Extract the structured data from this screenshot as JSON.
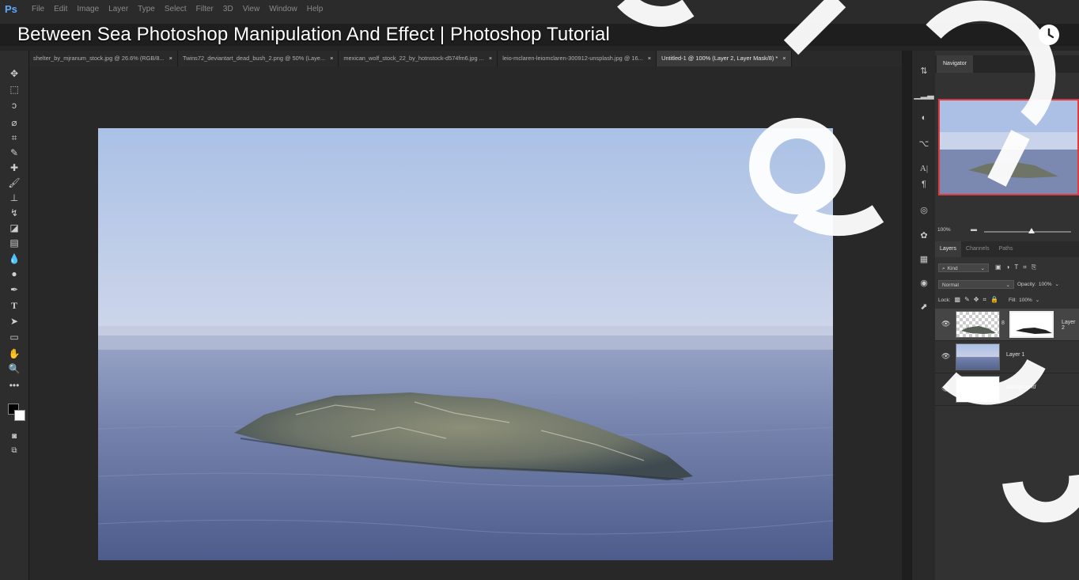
{
  "app": {
    "logo": "Ps",
    "menus": [
      "File",
      "Edit",
      "Image",
      "Layer",
      "Type",
      "Select",
      "Filter",
      "3D",
      "View",
      "Window",
      "Help"
    ]
  },
  "video_title": "Between Sea Photoshop Manipulation And Effect | Photoshop Tutorial",
  "tabs": [
    {
      "label": "shelter_by_mjranum_stock.jpg @ 26.6% (RGB/8...",
      "close": "×",
      "active": false
    },
    {
      "label": "Twins72_deviantart_dead_bush_2.png @ 50% (Laye...",
      "close": "×",
      "active": false
    },
    {
      "label": "mexican_wolf_stock_22_by_hotnstock-d574fm6.jpg ...",
      "close": "×",
      "active": false
    },
    {
      "label": "leio-mclaren-leiomclaren-300912-unsplash.jpg @ 16...",
      "close": "×",
      "active": false
    },
    {
      "label": "Untitled-1 @ 100% (Layer 2, Layer Mask/8) *",
      "close": "×",
      "active": true
    }
  ],
  "navigator": {
    "tab": "Navigator",
    "zoom": "100%"
  },
  "layers_panel": {
    "tabs": [
      "Layers",
      "Channels",
      "Paths"
    ],
    "filter_label": "Kind",
    "blend_mode": "Normal",
    "opacity_label": "Opacity:",
    "opacity_value": "100%",
    "lock_label": "Lock:",
    "fill_label": "Fill:",
    "fill_value": "100%",
    "layers": [
      {
        "name": "Layer 2",
        "selected": true
      },
      {
        "name": "Layer 1",
        "selected": false
      },
      {
        "name": "Background",
        "selected": false
      }
    ]
  },
  "icons": {
    "tools": [
      "move-tool-icon",
      "marquee-tool-icon",
      "lasso-tool-icon",
      "quick-select-icon",
      "crop-tool-icon",
      "eyedropper-icon",
      "healing-brush-icon",
      "brush-tool-icon",
      "clone-stamp-icon",
      "history-brush-icon",
      "eraser-icon",
      "gradient-icon",
      "blur-icon",
      "dodge-icon",
      "pen-tool-icon",
      "type-tool-icon",
      "path-select-icon",
      "rectangle-tool-icon",
      "hand-tool-icon",
      "zoom-tool-icon",
      "more-tools-icon"
    ],
    "accent_color": "#e0393e"
  }
}
